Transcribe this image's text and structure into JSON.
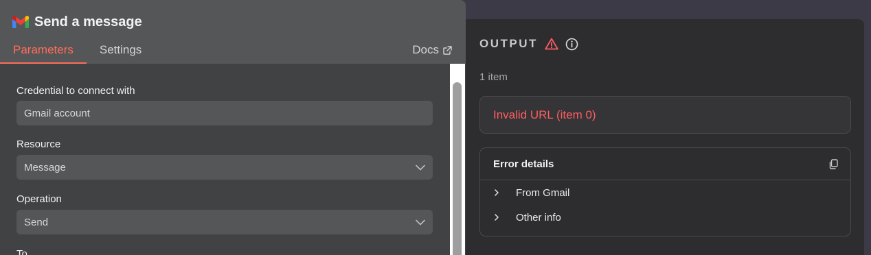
{
  "node": {
    "title": "Send a message",
    "tabs": [
      {
        "label": "Parameters",
        "active": true
      },
      {
        "label": "Settings",
        "active": false
      }
    ],
    "docs_label": "Docs"
  },
  "form": {
    "credential": {
      "label": "Credential to connect with",
      "value": "Gmail account"
    },
    "resource": {
      "label": "Resource",
      "value": "Message"
    },
    "operation": {
      "label": "Operation",
      "value": "Send"
    },
    "to": {
      "label": "To"
    }
  },
  "output": {
    "title": "OUTPUT",
    "item_count": "1 item",
    "error_message": "Invalid URL (item 0)",
    "details": {
      "title": "Error details",
      "rows": [
        {
          "label": "From Gmail"
        },
        {
          "label": "Other info"
        }
      ]
    }
  },
  "colors": {
    "accent": "#ff6d5a",
    "error": "#ff5c62",
    "left_panel_bg": "#414244",
    "right_panel_bg": "#2d2d2f"
  },
  "icons": [
    "gmail-logo",
    "external-link-icon",
    "chevron-down-icon",
    "warning-icon",
    "info-icon",
    "copy-icon",
    "chevron-right-icon"
  ]
}
